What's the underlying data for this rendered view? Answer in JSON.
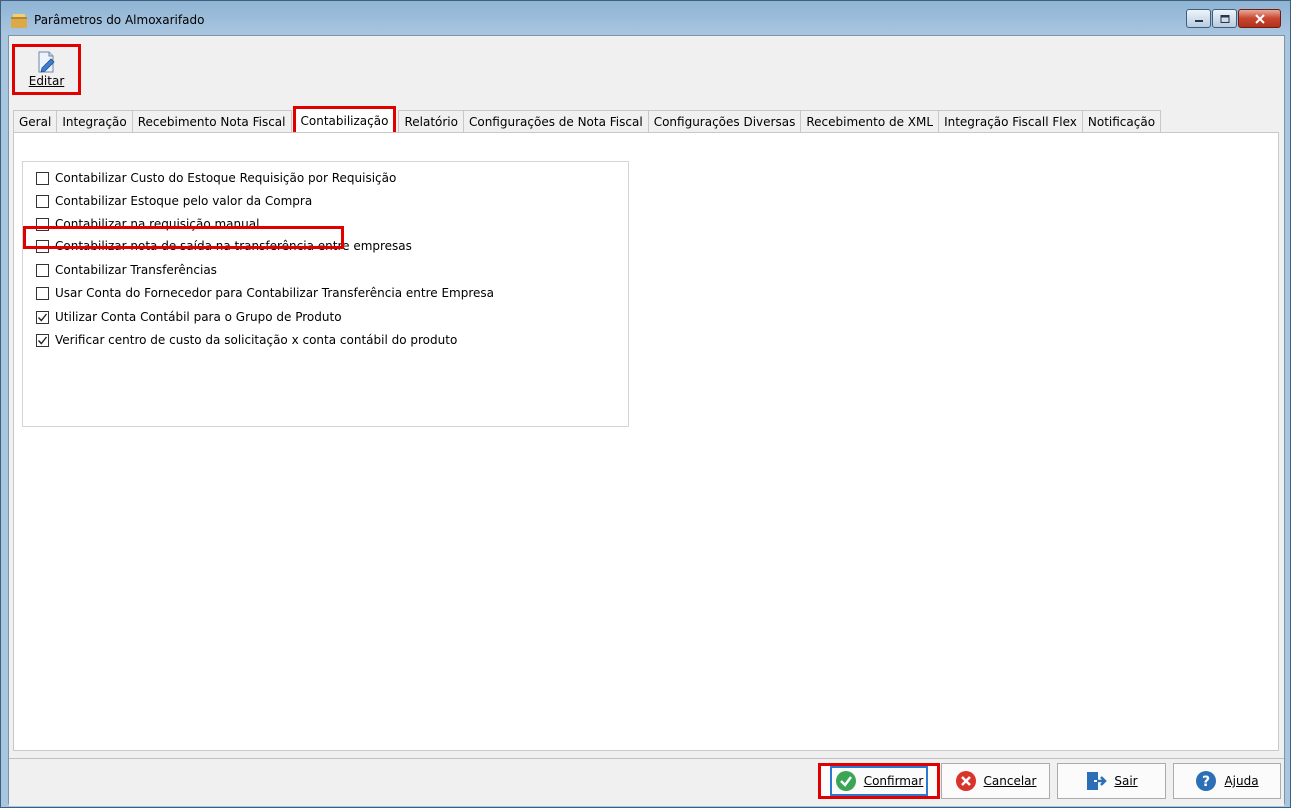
{
  "window": {
    "title": "Parâmetros do Almoxarifado"
  },
  "toolbar": {
    "edit_label": "Editar"
  },
  "tabs": [
    {
      "label": "Geral"
    },
    {
      "label": "Integração"
    },
    {
      "label": "Recebimento Nota Fiscal"
    },
    {
      "label": "Contabilização",
      "active": true
    },
    {
      "label": "Relatório"
    },
    {
      "label": "Configurações de Nota Fiscal"
    },
    {
      "label": "Configurações Diversas"
    },
    {
      "label": "Recebimento de XML"
    },
    {
      "label": "Integração Fiscall Flex"
    },
    {
      "label": "Notificação"
    }
  ],
  "options": [
    {
      "label": "Contabilizar Custo do Estoque Requisição por Requisição",
      "checked": false
    },
    {
      "label": "Contabilizar Estoque pelo valor da Compra",
      "checked": false
    },
    {
      "label": "Contabilizar na requisição manual",
      "checked": false
    },
    {
      "label": "Contabilizar nota de saída na transferência entre empresas",
      "checked": false
    },
    {
      "label": "Contabilizar Transferências",
      "checked": false
    },
    {
      "label": "Usar Conta do Fornecedor para Contabilizar Transferência entre Empresa",
      "checked": false
    },
    {
      "label": "Utilizar Conta Contábil para o Grupo de Produto",
      "checked": true
    },
    {
      "label": "Verificar centro de custo da solicitação x conta contábil do produto",
      "checked": true
    }
  ],
  "footer": {
    "confirm_label": "Confirmar",
    "cancel_label": "Cancelar",
    "exit_label": "Sair",
    "help_label": "Ajuda"
  },
  "colors": {
    "highlight": "#e00000",
    "confirm_icon": "#3aa655",
    "cancel_icon": "#d9342b",
    "exit_icon": "#2d6fb7",
    "help_icon": "#2d6fb7"
  }
}
